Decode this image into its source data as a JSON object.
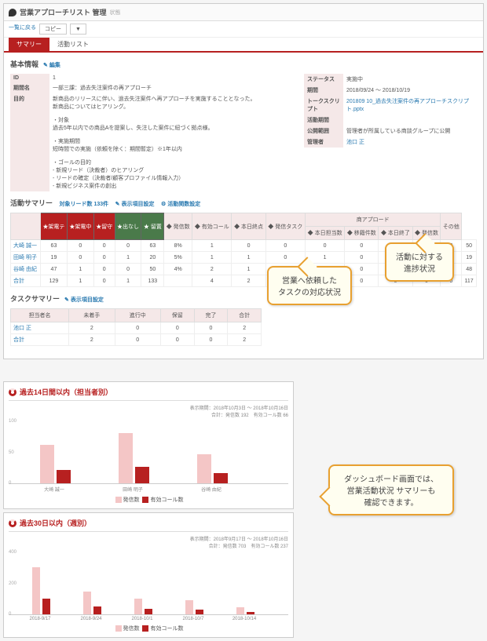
{
  "header": {
    "title": "営業アプローチリスト 管理",
    "subtitle": "状態"
  },
  "toolbar": {
    "back": "一覧に戻る",
    "copy": "コピー",
    "dd": "▼"
  },
  "tabs": [
    "サマリー",
    "活動リスト"
  ],
  "basic": {
    "title": "基本情報",
    "edit": "✎ 編集",
    "left_th": [
      "ID",
      "期間名",
      "目的"
    ],
    "left_td": [
      "1",
      "一部三課：過去失注案件の再アプローチ",
      "新商品のリリースに伴い、過去失注案件へ再アプローチを実施することとなった。\n新商品についてはヒアリング。\n\n・対象\n過去5年以内での商品Aを提案し、失注した案件に紐づく拠点様。\n\n・実施期間\n短時間での実施（依頼を除く：期間暫定）※1年以内\n\n・ゴールの目的\n- 新規リード（決裁者）のヒアリング\n- リードの確定（決裁者/顧客プロファイル情報入力）\n- 新規ビジネス案件の創出"
    ],
    "right_th": [
      "ステータス",
      "期間",
      "トークスクリプト",
      "活動期間",
      "公開範囲",
      "管理者"
    ],
    "right_td": [
      "実施中",
      "2018/09/24 ～ 2018/10/19",
      "201809 10_過去失注案件の再アプローチスクリプト.pptx",
      "",
      "管理者が所属している商談グループに公開",
      "池口 正"
    ]
  },
  "act": {
    "title": "活動サマリー",
    "linkA": "対象リード数 133件",
    "linkB": "✎ 表示項目設定",
    "linkC": "⚙ 活動関数設定",
    "th_dark": [
      "★架電テ",
      "★架電中",
      "★留守",
      "★出なし",
      "★ 留置"
    ],
    "th_lt": [
      "◆ 発信数",
      "◆ 有効コール",
      "◆ 本日終点",
      "◆ 発信タスク",
      "商アプロード",
      "その他"
    ],
    "th_sub": [
      "◆ 本日担当数",
      "◆ 移籍件数",
      "◆ 本日終了",
      "◆ 発信数"
    ],
    "rows": [
      {
        "name": "大崎 誠一",
        "c": [
          "63",
          "0",
          "0",
          "0",
          "63",
          "8%",
          "1",
          "0",
          "0",
          "0",
          "0",
          "0",
          "0",
          "0",
          "50"
        ]
      },
      {
        "name": "田崎 明子",
        "c": [
          "19",
          "0",
          "0",
          "1",
          "20",
          "5%",
          "1",
          "1",
          "0",
          "1",
          "0",
          "0",
          "0",
          "0",
          "19"
        ]
      },
      {
        "name": "谷崎 由紀",
        "c": [
          "47",
          "1",
          "0",
          "0",
          "50",
          "4%",
          "2",
          "1",
          "0",
          "0",
          "0",
          "0",
          "0",
          "0",
          "48"
        ]
      },
      {
        "name": "合計",
        "c": [
          "129",
          "1",
          "0",
          "1",
          "133",
          "",
          "4",
          "2",
          "0",
          "1",
          "0",
          "0",
          "0",
          "0",
          "117"
        ]
      }
    ]
  },
  "task": {
    "title": "タスクサマリー",
    "link": "✎ 表示項目設定",
    "th": [
      "担当者名",
      "未着手",
      "進行中",
      "保留",
      "完了",
      "合計"
    ],
    "rows": [
      {
        "name": "池口 正",
        "c": [
          "2",
          "0",
          "0",
          "0",
          "2"
        ]
      },
      {
        "name": "合計",
        "c": [
          "2",
          "0",
          "0",
          "0",
          "2"
        ]
      }
    ]
  },
  "callout1": "営業へ依頼した\nタスクの対応状況",
  "callout2": "活動に対する\n進捗状況",
  "callout3": "ダッシュボード画面では、\n営業活動状況 サマリーも\n確認できます。",
  "chart1": {
    "title": "過去14日間以内（担当者別）",
    "meta": "表示期間：2018年10月3日 ～ 2018年10月16日\n合計：発信数 192　有効コール数 66",
    "leg": [
      "発信数",
      "有効コール数"
    ]
  },
  "chart2": {
    "title": "過去30日以内（週別）",
    "meta": "表示期間：2018年9月17日 ～ 2018年10月16日\n合計：発信数 703　有効コール数 237",
    "leg": [
      "発信数",
      "有効コール数"
    ]
  },
  "chart_data": [
    {
      "type": "bar",
      "title": "過去14日間以内（担当者別）",
      "ylabel": "",
      "ylim": [
        0,
        100
      ],
      "categories": [
        "大崎 誠一",
        "田崎 明子",
        "谷崎 由紀"
      ],
      "series": [
        {
          "name": "発信数",
          "values": [
            63,
            82,
            47
          ]
        },
        {
          "name": "有効コール数",
          "values": [
            22,
            27,
            17
          ]
        }
      ]
    },
    {
      "type": "bar",
      "title": "過去30日以内（週別）",
      "ylabel": "",
      "ylim": [
        0,
        400
      ],
      "categories": [
        "2018-9/17",
        "2018-9/24",
        "2018-10/1",
        "2018-10/7",
        "2018-10/14"
      ],
      "series": [
        {
          "name": "発信数",
          "values": [
            310,
            150,
            105,
            90,
            48
          ]
        },
        {
          "name": "有効コール数",
          "values": [
            105,
            50,
            35,
            30,
            17
          ]
        }
      ]
    }
  ]
}
